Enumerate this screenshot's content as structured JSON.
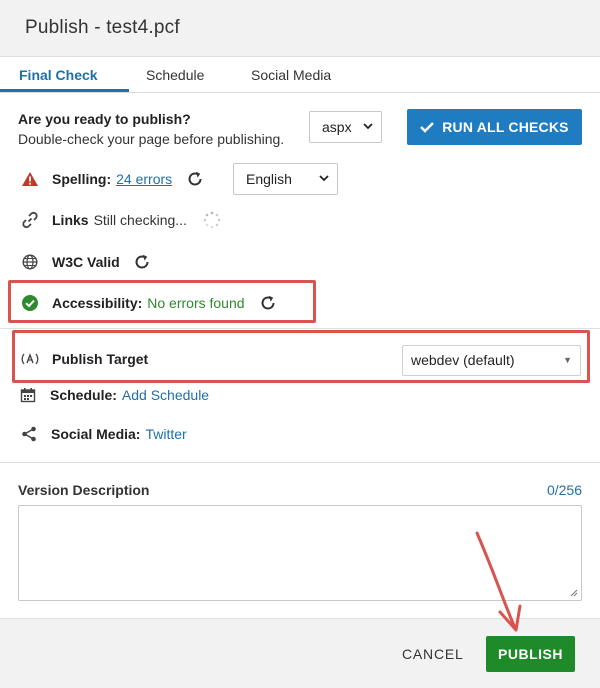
{
  "window": {
    "title": "Publish - test4.pcf"
  },
  "tabs": [
    {
      "label": "Final Check",
      "active": true
    },
    {
      "label": "Schedule",
      "active": false
    },
    {
      "label": "Social Media",
      "active": false
    }
  ],
  "ready": {
    "title": "Are you ready to publish?",
    "subtitle": "Double-check your page before publishing.",
    "extension_select": "aspx",
    "run_all_label": "RUN ALL CHECKS"
  },
  "checks": {
    "spelling": {
      "label": "Spelling:",
      "value": "24 errors",
      "language": "English"
    },
    "links": {
      "label": "Links",
      "value": "Still checking..."
    },
    "w3c": {
      "label": "W3C Valid"
    },
    "accessibility": {
      "label": "Accessibility:",
      "value": "No errors found"
    }
  },
  "publish_target": {
    "label": "Publish Target",
    "value": "webdev (default)"
  },
  "schedule": {
    "label": "Schedule:",
    "link": "Add Schedule"
  },
  "social": {
    "label": "Social Media:",
    "link": "Twitter"
  },
  "version": {
    "label": "Version Description",
    "count": "0/256",
    "value": ""
  },
  "footer": {
    "cancel_label": "CANCEL",
    "publish_label": "PUBLISH"
  },
  "colors": {
    "primary": "#1f7cc1",
    "link": "#1f6fa8",
    "success": "#2e8a2e",
    "publish": "#1e8a2a",
    "warning": "#c0392b",
    "annotation": "#d9534f"
  }
}
